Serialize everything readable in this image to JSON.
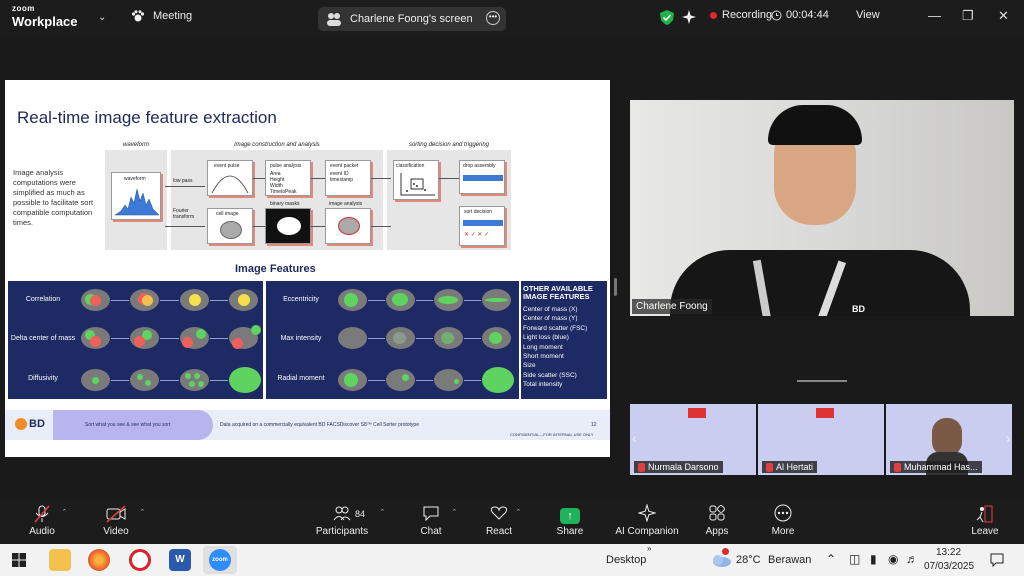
{
  "app": {
    "line1": "zoom",
    "line2": "Workplace"
  },
  "meeting": {
    "label": "Meeting"
  },
  "share_banner": {
    "label": "Charlene Foong's screen"
  },
  "status": {
    "recording": "Recording",
    "timer": "00:04:44",
    "view": "View"
  },
  "slide": {
    "title": "Real-time image feature extraction",
    "description": "Image analysis computations were simplified as much as possible to facilitate sort compatible computation times.",
    "headers": {
      "waveform": "waveform",
      "construction": "image construction and analysis",
      "sorting": "sorting decision and triggering"
    },
    "flow": {
      "waveform": "waveform",
      "low_pass": "low pass",
      "fourier": "Fourier transform",
      "event_pulse": "event pulse",
      "pulse_analysis": "pulse analysis",
      "pulse_items": "Area Height Width TimetoPeak",
      "event_packet": "event packet",
      "packet_items": "event ID timestamp",
      "cell_image": "cell image",
      "binary_masks": "binary masks",
      "image_analysis": "image analysis",
      "classification": "classification",
      "drop_assembly": "drop assembly",
      "sort_decision": "sort decision"
    },
    "image_features_title": "Image Features",
    "left_features": [
      "Correlation",
      "Delta center of mass",
      "Diffusivity"
    ],
    "right_features": [
      "Eccentricity",
      "Max intensity",
      "Radial moment"
    ],
    "other_title": "OTHER AVAILABLE IMAGE FEATURES",
    "other_items": [
      "Center of mass (X)",
      "Center of mass (Y)",
      "Forward scatter (FSC)",
      "Light loss (blue)",
      "Long moment",
      "Short moment",
      "Size",
      "Side scatter (SSC)",
      "Total intensity"
    ],
    "footer": {
      "logo": "BD",
      "tagline": "Sort what you see & see what you sort",
      "note": "Data acquired on a commercially equivalent BD FACSDiscover S8™ Cell Sorter prototype",
      "page": "12",
      "confidential": "CONFIDENTIAL—FOR INTERNAL USE ONLY"
    }
  },
  "speaker": {
    "name": "Charlene Foong",
    "badge": "BD"
  },
  "thumbnails": [
    {
      "name": "Nurmala Darsono"
    },
    {
      "name": "Al Hertati"
    },
    {
      "name": "Muhammad Has..."
    }
  ],
  "toolbar": {
    "audio": "Audio",
    "video": "Video",
    "participants": "Participants",
    "participant_count": "84",
    "chat": "Chat",
    "react": "React",
    "share": "Share",
    "ai": "AI Companion",
    "apps": "Apps",
    "more": "More",
    "leave": "Leave"
  },
  "taskbar": {
    "desktop": "Desktop",
    "weather_temp": "28°C",
    "weather_desc": "Berawan",
    "time": "13:22",
    "date": "07/03/2025",
    "zoom_app": "zoom",
    "word_app": "W"
  },
  "colors": {
    "recording": "#e02828",
    "share": "#20b35b",
    "slide_navy": "#1d2a63",
    "cell_green": "#5fd35f",
    "cell_red": "#f0605a",
    "cell_yellow": "#f5e04a"
  }
}
